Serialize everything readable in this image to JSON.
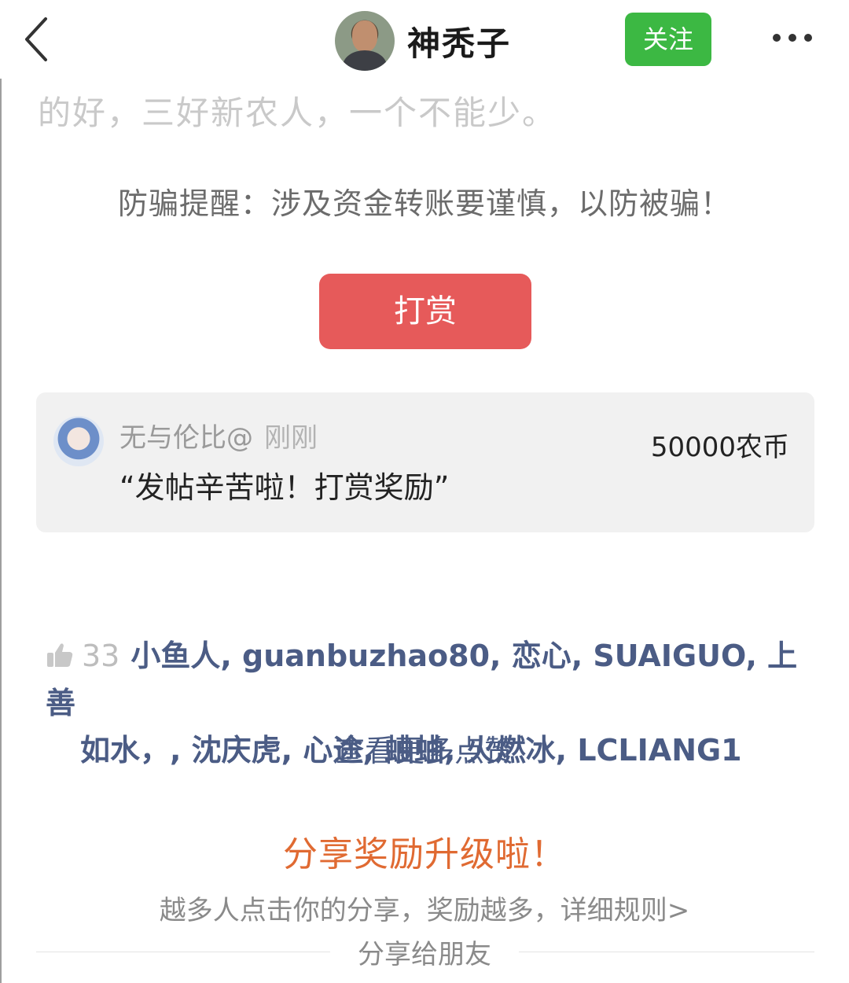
{
  "header": {
    "username": "神秃子",
    "follow_label": "关注",
    "more_icon": "more-dots-icon",
    "back_icon": "chevron-left-icon"
  },
  "post": {
    "faded_text": "的好，三好新农人，一个不能少。",
    "fraud_warning": "防骗提醒：涉及资金转账要谨慎，以防被骗！",
    "tip_button_label": "打赏"
  },
  "reward": {
    "user_name": "无与伦比@",
    "time": "刚刚",
    "amount": "50000农币",
    "message": "“发帖辛苦啦！打赏奖励”"
  },
  "likes": {
    "count": "33",
    "names_line1": "小鱼人, guanbuzhao80, 恋心, SUAIGUO, 上善",
    "names_line2": "如水，, 沈庆虎, 心途, 蛐蛐, 火燃冰, LCLIANG1",
    "view_more": "查看更多点赞"
  },
  "share": {
    "title": "分享奖励升级啦！",
    "description": "越多人点击你的分享，奖励越多，",
    "rule_link": "详细规则>",
    "share_to_friends": "分享给朋友"
  },
  "colors": {
    "follow_green": "#3cb843",
    "tip_red": "#e65a5a",
    "link_blue": "#4b5c85",
    "share_orange": "#e06a32"
  }
}
